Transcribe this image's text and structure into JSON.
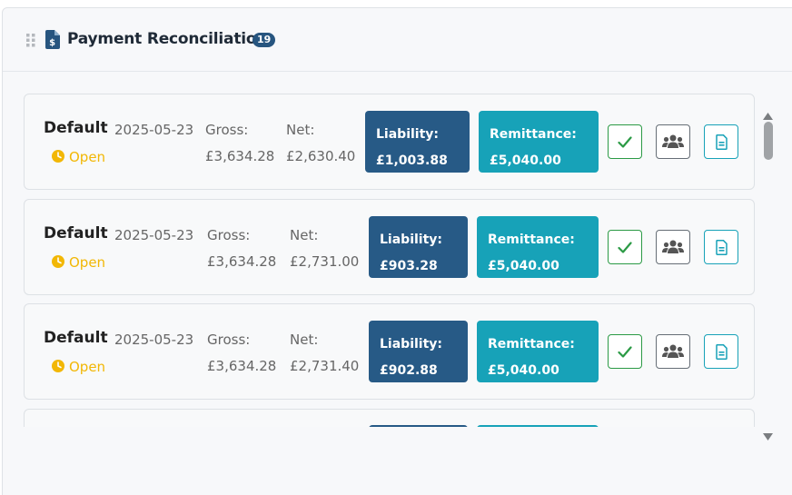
{
  "header": {
    "title": "Payment Reconciliation",
    "count": "19",
    "drag_icon": "drag-handle-icon",
    "title_icon": "file-invoice-dollar-icon"
  },
  "labels": {
    "gross": "Gross:",
    "net": "Net:",
    "liability": "Liability:",
    "remittance": "Remittance:"
  },
  "cards": [
    {
      "name": "Default",
      "date": "2025-05-23",
      "status": "Open",
      "gross": "£3,634.28",
      "net": "£2,630.40",
      "liability": "£1,003.88",
      "remittance": "£5,040.00"
    },
    {
      "name": "Default",
      "date": "2025-05-23",
      "status": "Open",
      "gross": "£3,634.28",
      "net": "£2,731.00",
      "liability": "£903.28",
      "remittance": "£5,040.00"
    },
    {
      "name": "Default",
      "date": "2025-05-23",
      "status": "Open",
      "gross": "£3,634.28",
      "net": "£2,731.40",
      "liability": "£902.88",
      "remittance": "£5,040.00"
    }
  ],
  "colors": {
    "liability_bg": "#275a86",
    "remittance_bg": "#17a2b8",
    "status_open": "#f2b705",
    "approve": "#2b9a45"
  },
  "icons": {
    "status": "clock-icon",
    "approve": "check-icon",
    "employees": "users-icon",
    "report": "file-text-icon",
    "scroll_up": "scroll-up-arrow-icon",
    "scroll_down": "scroll-down-arrow-icon"
  }
}
